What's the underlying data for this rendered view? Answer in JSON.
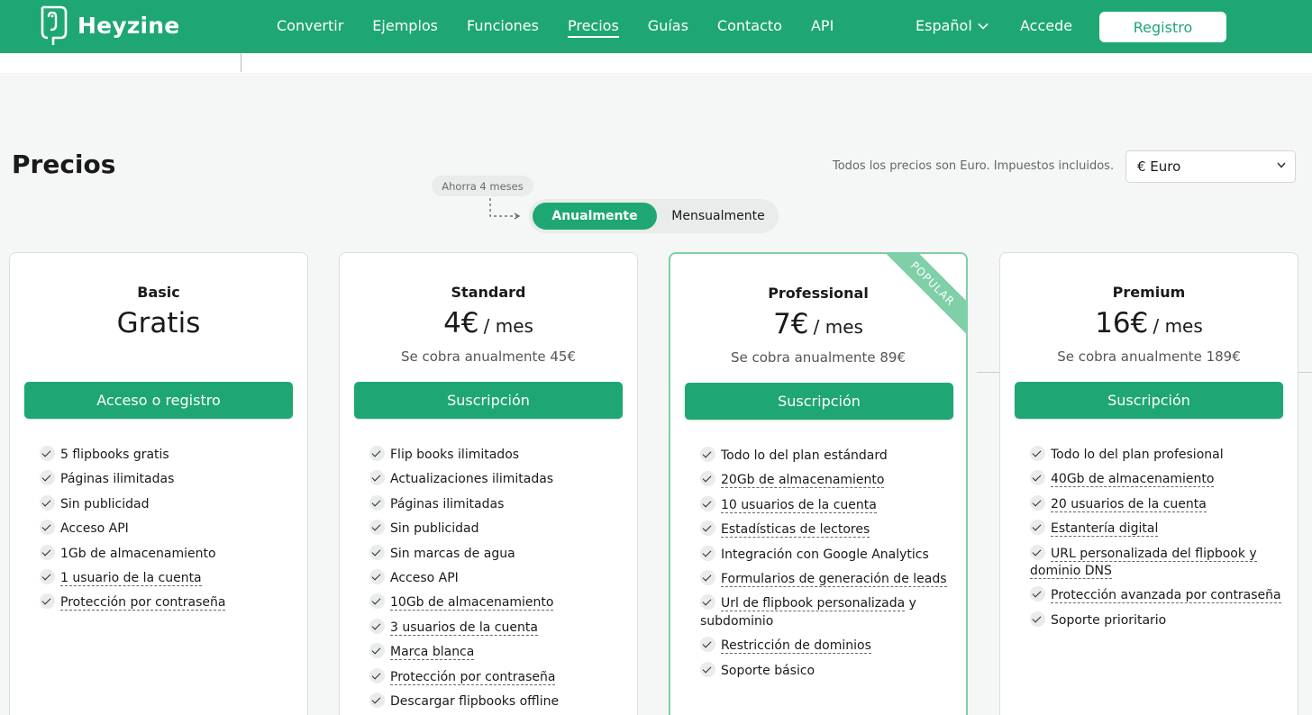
{
  "header": {
    "brand": "Heyzine",
    "nav": [
      {
        "label": "Convertir",
        "active": false
      },
      {
        "label": "Ejemplos",
        "active": false
      },
      {
        "label": "Funciones",
        "active": false
      },
      {
        "label": "Precios",
        "active": true
      },
      {
        "label": "Guías",
        "active": false
      },
      {
        "label": "Contacto",
        "active": false
      },
      {
        "label": "API",
        "active": false
      }
    ],
    "language": "Español",
    "login": "Accede",
    "register": "Registro"
  },
  "pricing": {
    "title": "Precios",
    "tax_note": "Todos los precios son Euro. Impuestos incluidos.",
    "currency": "€ Euro",
    "save_badge": "Ahorra 4 meses",
    "billing_annual": "Anualmente",
    "billing_monthly": "Mensualmente"
  },
  "colors": {
    "brand": "#1ea773",
    "popular_ribbon": "#7fcfa9"
  },
  "plans": [
    {
      "name": "Basic",
      "price": "Gratis",
      "cta": "Acceso o registro",
      "features": [
        {
          "text": "5 flipbooks gratis"
        },
        {
          "text": "Páginas ilimitadas"
        },
        {
          "text": "Sin publicidad"
        },
        {
          "text": "Acceso API"
        },
        {
          "text": "1Gb de almacenamiento"
        },
        {
          "text": "1 usuario de la cuenta"
        },
        {
          "text": "Protección por contraseña"
        }
      ]
    },
    {
      "name": "Standard",
      "price": "4€",
      "unit": "/ mes",
      "billed": "Se cobra anualmente 45€",
      "cta": "Suscripción",
      "features": [
        {
          "text": "Flip books ilimitados"
        },
        {
          "text": "Actualizaciones ilimitadas"
        },
        {
          "text": "Páginas ilimitadas"
        },
        {
          "text": "Sin publicidad"
        },
        {
          "text": "Sin marcas de agua"
        },
        {
          "text": "Acceso API"
        },
        {
          "text": "10Gb de almacenamiento"
        },
        {
          "text": "3 usuarios de la cuenta"
        },
        {
          "text": "Marca blanca"
        },
        {
          "text": "Protección por contraseña"
        },
        {
          "text": "Descargar flipbooks offline"
        }
      ]
    },
    {
      "name": "Professional",
      "price": "7€",
      "unit": "/ mes",
      "billed": "Se cobra anualmente 89€",
      "cta": "Suscripción",
      "ribbon": "POPULAR",
      "features": [
        {
          "text": "Todo lo del plan estándard"
        },
        {
          "text": "20Gb de almacenamiento"
        },
        {
          "text": "10 usuarios de la cuenta"
        },
        {
          "text": "Estadísticas de lectores"
        },
        {
          "text": "Integración con Google Analytics"
        },
        {
          "text": "Formularios de generación de leads"
        },
        {
          "text": "Url de flipbook personalizada",
          "suffix": " y subdominio"
        },
        {
          "text": "Restricción de dominios"
        },
        {
          "text": "Soporte básico"
        }
      ]
    },
    {
      "name": "Premium",
      "price": "16€",
      "unit": "/ mes",
      "billed": "Se cobra anualmente 189€",
      "cta": "Suscripción",
      "features": [
        {
          "text": "Todo lo del plan profesional"
        },
        {
          "text": "40Gb de almacenamiento"
        },
        {
          "text": "20 usuarios de la cuenta"
        },
        {
          "text": "Estantería digital"
        },
        {
          "text": "URL personalizada del flipbook y dominio DNS"
        },
        {
          "text": "Protección avanzada por contraseña"
        },
        {
          "text": "Soporte prioritario"
        }
      ]
    }
  ]
}
